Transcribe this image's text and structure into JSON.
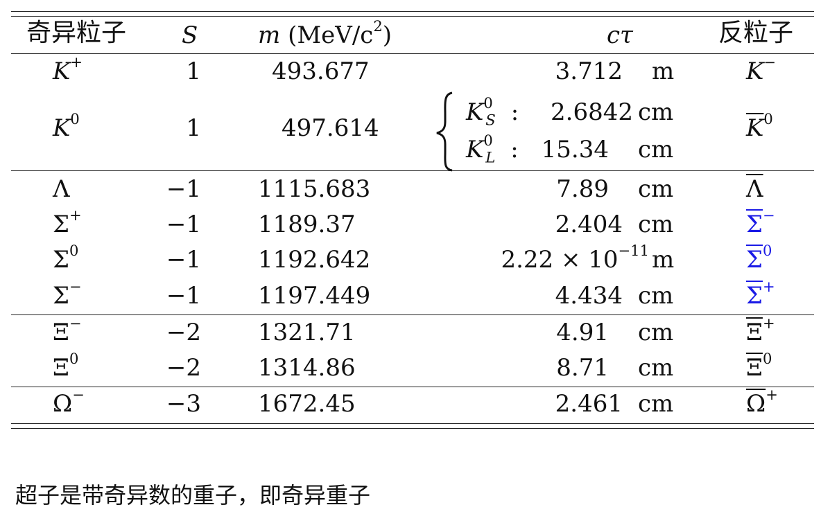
{
  "table": {
    "headers": {
      "particle": "奇异粒子",
      "s": "S",
      "mass_m": "m",
      "mass_unit": "(MeV/c",
      "mass_exp": "2",
      "mass_close": ")",
      "ctau": "cτ",
      "antiparticle": "反粒子"
    },
    "rows": [
      {
        "base": "K",
        "sup": "+",
        "italic": true,
        "s": "1",
        "mass": "493.677",
        "ctau_val": "3.712",
        "ctau_unit": "m",
        "anti_base": "K",
        "anti_sup": "−",
        "anti_bar": false,
        "anti_italic": true,
        "anti_blue": false
      },
      {
        "base": "K",
        "sup": "0",
        "italic": true,
        "s": "1",
        "mass": "497.614",
        "anti_base": "K",
        "anti_sup": "0",
        "anti_bar": true,
        "anti_italic": true,
        "anti_blue": false,
        "ctau_split": [
          {
            "sym": "K",
            "sup": "0",
            "sub": "S",
            "colon": ":",
            "val": "2.6842",
            "unit": "cm"
          },
          {
            "sym": "K",
            "sup": "0",
            "sub": "L",
            "colon": ":",
            "val": "15.34",
            "unit": "cm"
          }
        ]
      },
      {
        "base": "Λ",
        "sup": "",
        "italic": false,
        "s": "−1",
        "mass": "1115.683",
        "ctau_val": "7.89",
        "ctau_unit": "cm",
        "anti_base": "Λ",
        "anti_sup": "",
        "anti_bar": true,
        "anti_italic": false,
        "anti_blue": false
      },
      {
        "base": "Σ",
        "sup": "+",
        "italic": false,
        "s": "−1",
        "mass": "1189.37",
        "ctau_val": "2.404",
        "ctau_unit": "cm",
        "anti_base": "Σ",
        "anti_sup": "−",
        "anti_bar": true,
        "anti_italic": false,
        "anti_blue": true
      },
      {
        "base": "Σ",
        "sup": "0",
        "italic": false,
        "s": "−1",
        "mass": "1192.642",
        "ctau_val": "2.22 × 10",
        "ctau_exp": "−11",
        "ctau_unit": "m",
        "anti_base": "Σ",
        "anti_sup": "0",
        "anti_bar": true,
        "anti_italic": false,
        "anti_blue": true
      },
      {
        "base": "Σ",
        "sup": "−",
        "italic": false,
        "s": "−1",
        "mass": "1197.449",
        "ctau_val": "4.434",
        "ctau_unit": "cm",
        "anti_base": "Σ",
        "anti_sup": "+",
        "anti_bar": true,
        "anti_italic": false,
        "anti_blue": true
      },
      {
        "base": "Ξ",
        "sup": "−",
        "italic": false,
        "s": "−2",
        "mass": "1321.71",
        "ctau_val": "4.91",
        "ctau_unit": "cm",
        "anti_base": "Ξ",
        "anti_sup": "+",
        "anti_bar": true,
        "anti_italic": false,
        "anti_blue": false
      },
      {
        "base": "Ξ",
        "sup": "0",
        "italic": false,
        "s": "−2",
        "mass": "1314.86",
        "ctau_val": "8.71",
        "ctau_unit": "cm",
        "anti_base": "Ξ",
        "anti_sup": "0",
        "anti_bar": true,
        "anti_italic": false,
        "anti_blue": false
      },
      {
        "base": "Ω",
        "sup": "−",
        "italic": false,
        "s": "−3",
        "mass": "1672.45",
        "ctau_val": "2.461",
        "ctau_unit": "cm",
        "anti_base": "Ω",
        "anti_sup": "+",
        "anti_bar": true,
        "anti_italic": false,
        "anti_blue": false
      }
    ]
  },
  "caption": "超子是带奇异数的重子，即奇异重子",
  "colors": {
    "highlight": "#1a1ae6",
    "text": "#111111"
  }
}
